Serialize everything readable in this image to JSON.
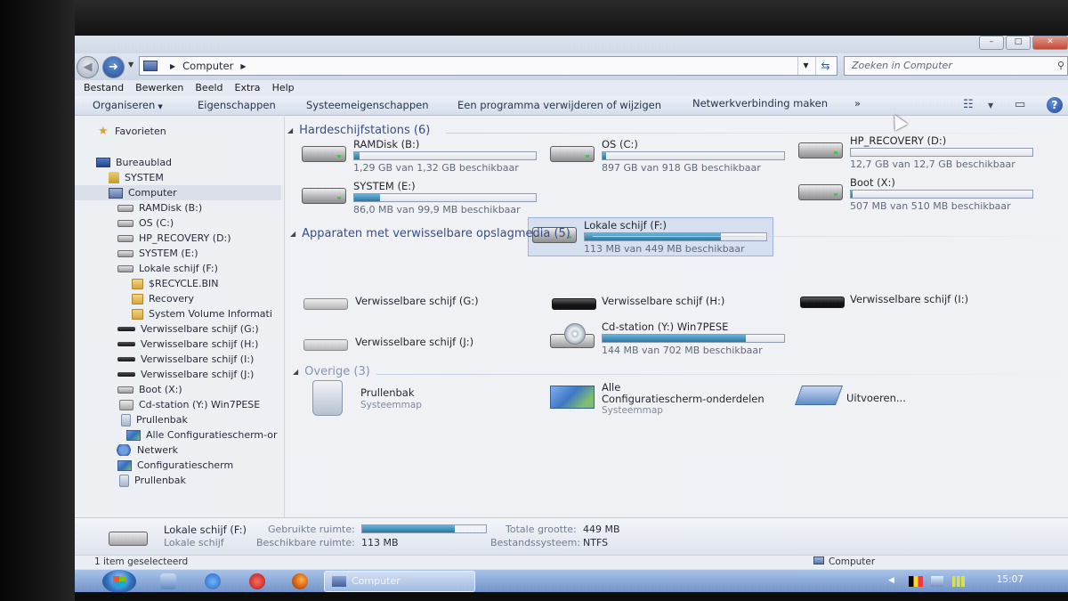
{
  "window": {
    "controls": [
      "–",
      "□",
      "✕"
    ]
  },
  "address": {
    "crumb": "Computer",
    "search_placeholder": "Zoeken in Computer"
  },
  "menu": [
    "Bestand",
    "Bewerken",
    "Beeld",
    "Extra",
    "Help"
  ],
  "commands": {
    "organize": "Organiseren",
    "properties": "Eigenschappen",
    "system_properties": "Systeemeigenschappen",
    "uninstall": "Een programma verwijderen of wijzigen",
    "map_network": "Netwerkverbinding maken",
    "more": "»"
  },
  "sidebar": {
    "favorites": "Favorieten",
    "desktop": "Bureaublad",
    "system_user": "SYSTEM",
    "computer": "Computer",
    "items": [
      "RAMDisk (B:)",
      "OS (C:)",
      "HP_RECOVERY (D:)",
      "SYSTEM (E:)",
      "Lokale schijf (F:)",
      "$RECYCLE.BIN",
      "Recovery",
      "System Volume Informati",
      "Verwisselbare schijf (G:)",
      "Verwisselbare schijf (H:)",
      "Verwisselbare schijf (I:)",
      "Verwisselbare schijf (J:)",
      "Boot (X:)",
      "Cd-station (Y:) Win7PESE",
      "Prullenbak",
      "Alle Configuratiescherm-or"
    ],
    "network": "Netwerk",
    "control_panel": "Configuratiescherm",
    "recycle_bin": "Prullenbak"
  },
  "groups": {
    "hdd_title": "Hardeschijfstations (6)",
    "removable_title": "Apparaten met verwisselbare opslagmedia (5)",
    "other_title": "Overige (3)"
  },
  "drives": [
    {
      "name": "RAMDisk (B:)",
      "info": "1,29 GB van 1,32 GB beschikbaar",
      "used_fraction": 0.03
    },
    {
      "name": "OS (C:)",
      "info": "897 GB van 918 GB beschikbaar",
      "used_fraction": 0.02
    },
    {
      "name": "HP_RECOVERY (D:)",
      "info": "12,7 GB van 12,7 GB beschikbaar",
      "used_fraction": 0.0
    },
    {
      "name": "SYSTEM (E:)",
      "info": "86,0 MB van 99,9 MB beschikbaar",
      "used_fraction": 0.14
    },
    {
      "name": "Lokale schijf (F:)",
      "info": "113 MB van 449 MB beschikbaar",
      "used_fraction": 0.75
    },
    {
      "name": "Boot (X:)",
      "info": "507 MB van 510 MB beschikbaar",
      "used_fraction": 0.01
    }
  ],
  "removable": [
    {
      "name": "Verwisselbare schijf (G:)"
    },
    {
      "name": "Verwisselbare schijf (H:)"
    },
    {
      "name": "Verwisselbare schijf (I:)"
    },
    {
      "name": "Verwisselbare schijf (J:)"
    },
    {
      "name": "Cd-station (Y:) Win7PESE",
      "info": "144 MB van 702 MB beschikbaar",
      "used_fraction": 0.79
    }
  ],
  "others": [
    {
      "name": "Prullenbak",
      "sub": "Systeemmap"
    },
    {
      "name_line1": "Alle",
      "name_line2": "Configuratiescherm-onderdelen",
      "sub": "Systeemmap"
    },
    {
      "name": "Uitvoeren..."
    }
  ],
  "details": {
    "name": "Lokale schijf (F:)",
    "type": "Lokale schijf",
    "used_label": "Gebruikte ruimte:",
    "free_label": "Beschikbare ruimte:",
    "free_value": "113 MB",
    "total_label": "Totale grootte:",
    "total_value": "449 MB",
    "fs_label": "Bestandssysteem:",
    "fs_value": "NTFS",
    "used_fraction": 0.75
  },
  "status": {
    "selected": "1 item geselecteerd",
    "location": "Computer"
  },
  "taskbar": {
    "active_window": "Computer",
    "clock": "15:07"
  }
}
